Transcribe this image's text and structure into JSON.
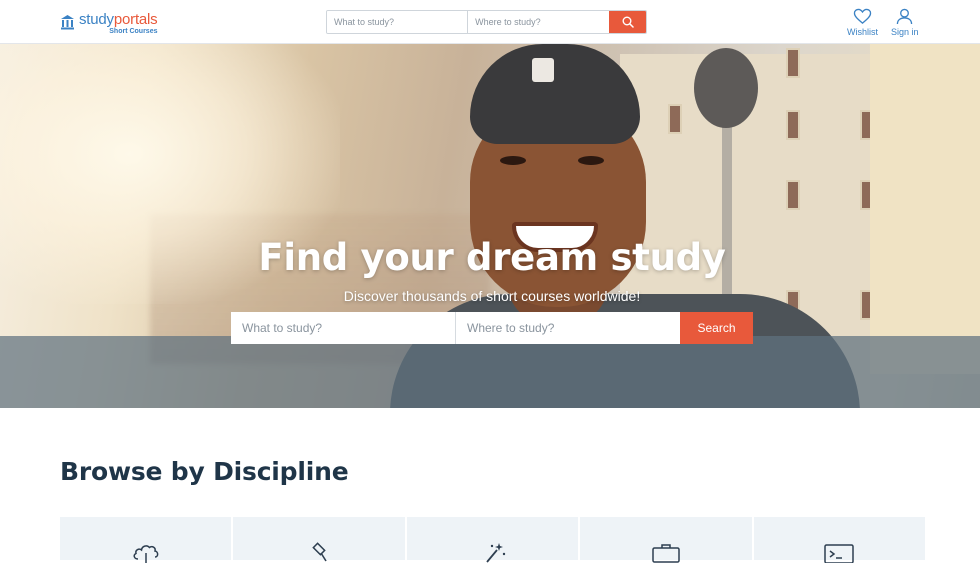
{
  "brand": {
    "name_left": "study",
    "name_right": "portals",
    "subtitle": "Short Courses"
  },
  "top_search": {
    "what_placeholder": "What to study?",
    "where_placeholder": "Where to study?"
  },
  "nav": {
    "wishlist": "Wishlist",
    "signin": "Sign in"
  },
  "hero": {
    "title": "Find your dream study",
    "subtitle": "Discover thousands of short courses worldwide!",
    "what_placeholder": "What to study?",
    "where_placeholder": "Where to study?",
    "search_label": "Search"
  },
  "browse": {
    "title": "Browse by Discipline",
    "disciplines": [
      {
        "icon": "cloud-tree-icon"
      },
      {
        "icon": "gavel-icon"
      },
      {
        "icon": "magic-wand-icon"
      },
      {
        "icon": "briefcase-icon"
      },
      {
        "icon": "terminal-icon"
      }
    ]
  },
  "colors": {
    "accent": "#e8593b",
    "brand_blue": "#3b82c4",
    "heading": "#1f3548"
  }
}
